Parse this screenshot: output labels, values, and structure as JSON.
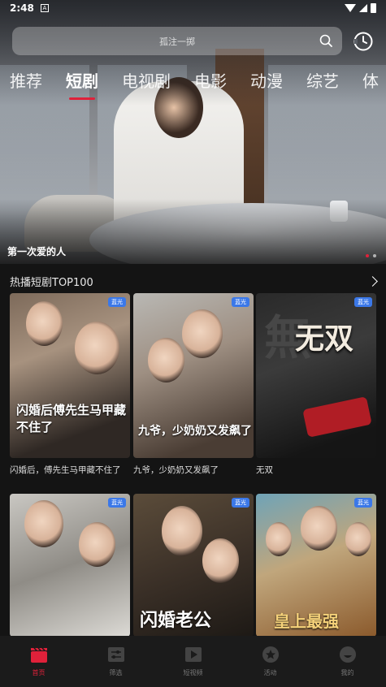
{
  "status_bar": {
    "time": "2:48",
    "notification_icon": "A"
  },
  "search": {
    "placeholder": "孤注一掷"
  },
  "tabs": [
    {
      "label": "推荐",
      "active": false
    },
    {
      "label": "短剧",
      "active": true
    },
    {
      "label": "电视剧",
      "active": false
    },
    {
      "label": "电影",
      "active": false
    },
    {
      "label": "动漫",
      "active": false
    },
    {
      "label": "综艺",
      "active": false
    },
    {
      "label": "体",
      "active": false
    }
  ],
  "hero": {
    "title": "第一次爱的人",
    "page_count": 2,
    "active_page": 1
  },
  "section": {
    "title": "热播短剧TOP100"
  },
  "cards": [
    {
      "title": "闪婚后，傅先生马甲藏不住了",
      "badge": "蓝光",
      "poster_text": "闪婚后傅先生马甲藏不住了"
    },
    {
      "title": "九爷，少奶奶又发飙了",
      "badge": "蓝光",
      "poster_text": "九爷，少奶奶又发飙了"
    },
    {
      "title": "无双",
      "badge": "蓝光",
      "poster_text": "无双"
    },
    {
      "title": "",
      "badge": "蓝光",
      "poster_text": ""
    },
    {
      "title": "",
      "badge": "蓝光",
      "poster_text": "闪婚老公"
    },
    {
      "title": "",
      "badge": "蓝光",
      "poster_text": "皇上最强"
    }
  ],
  "bottom_nav": [
    {
      "label": "首页",
      "icon": "clapperboard-icon",
      "active": true
    },
    {
      "label": "筛选",
      "icon": "filter-icon",
      "active": false
    },
    {
      "label": "短视频",
      "icon": "play-icon",
      "active": false
    },
    {
      "label": "活动",
      "icon": "star-icon",
      "active": false
    },
    {
      "label": "我的",
      "icon": "profile-icon",
      "active": false
    }
  ],
  "colors": {
    "accent": "#e0213a",
    "badge": "#3b78e8",
    "background": "#141414"
  }
}
